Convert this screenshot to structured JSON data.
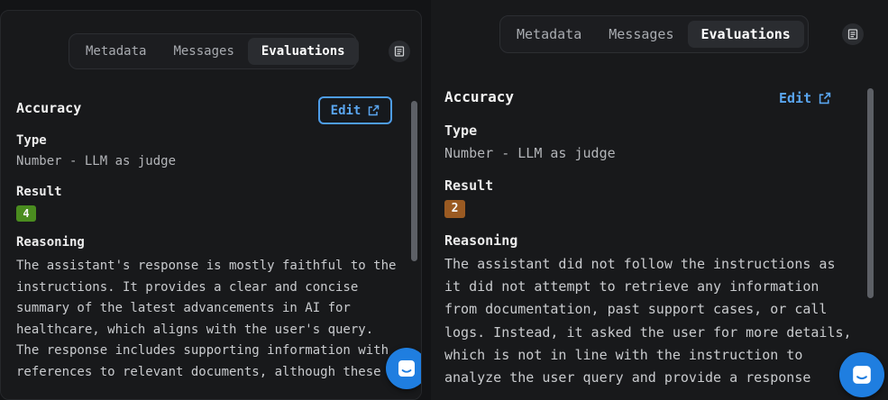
{
  "colors": {
    "accent": "#1f7ee0",
    "link": "#5aa6f0",
    "badge_good": "#4a8c1f",
    "badge_warn": "#9a5a22"
  },
  "left": {
    "tabs": [
      {
        "label": "Metadata",
        "active": false
      },
      {
        "label": "Messages",
        "active": false
      },
      {
        "label": "Evaluations",
        "active": true
      }
    ],
    "doc_icon": "scroll-icon",
    "eval": {
      "title": "Accuracy",
      "edit_label": "Edit",
      "type_label": "Type",
      "type_value": "Number - LLM as judge",
      "result_label": "Result",
      "result_value": "4",
      "reasoning_label": "Reasoning",
      "reasoning_lines": [
        "The assistant's response is mostly faithful to the",
        "instructions. It provides a clear and concise",
        "summary of the latest advancements in AI for",
        "healthcare, which aligns with the user's query.",
        "The response includes supporting information with",
        "references to relevant documents, although these"
      ]
    },
    "chat_icon": "chat-icon"
  },
  "right": {
    "tabs": [
      {
        "label": "Metadata",
        "active": false
      },
      {
        "label": "Messages",
        "active": false
      },
      {
        "label": "Evaluations",
        "active": true
      }
    ],
    "doc_icon": "scroll-icon",
    "eval": {
      "title": "Accuracy",
      "edit_label": "Edit",
      "type_label": "Type",
      "type_value": "Number - LLM as judge",
      "result_label": "Result",
      "result_value": "2",
      "reasoning_label": "Reasoning",
      "reasoning_lines": [
        "The assistant did not follow the instructions as",
        "it did not attempt to retrieve any information",
        "from documentation, past support cases, or call",
        "logs. Instead, it asked the user for more details,",
        "which is not in line with the instruction to",
        "analyze the user query and provide a response"
      ]
    },
    "chat_icon": "chat-icon"
  }
}
